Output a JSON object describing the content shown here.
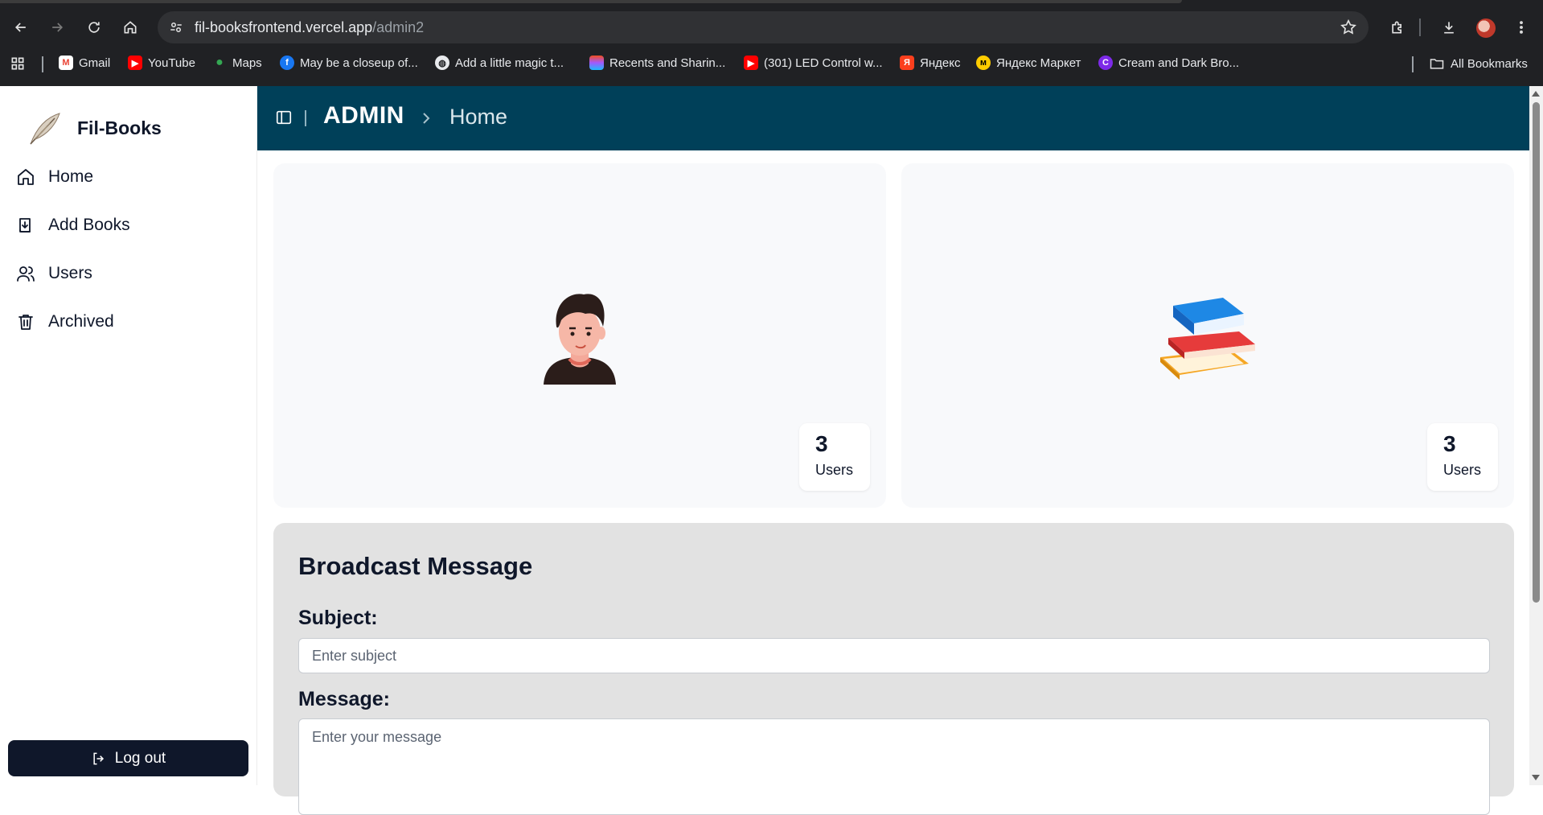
{
  "browser": {
    "url_host": "fil-booksfrontend.vercel.app",
    "url_path": "/admin2",
    "bookmarks": [
      {
        "label": "Gmail",
        "icon": "gmail-icon",
        "color": "#ea4335"
      },
      {
        "label": "YouTube",
        "icon": "youtube-icon",
        "color": "#ff0000"
      },
      {
        "label": "Maps",
        "icon": "maps-icon",
        "color": "#34a853"
      },
      {
        "label": "May be a closeup of...",
        "icon": "facebook-icon",
        "color": "#1877f2"
      },
      {
        "label": "Add a little magic t...",
        "icon": "globe-icon",
        "color": "#9aa0a6"
      },
      {
        "label": "Recents and Sharin...",
        "icon": "figma-icon",
        "color": "#a259ff"
      },
      {
        "label": "(301) LED Control w...",
        "icon": "youtube-icon",
        "color": "#ff0000"
      },
      {
        "label": "Яндекс",
        "icon": "yandex-icon",
        "color": "#fc3f1d"
      },
      {
        "label": "Яндекс Маркет",
        "icon": "yandex-market-icon",
        "color": "#ffcc00"
      },
      {
        "label": "Cream and Dark Bro...",
        "icon": "canva-icon",
        "color": "#7d2ae8"
      }
    ],
    "all_bookmarks": "All Bookmarks"
  },
  "sidebar": {
    "brand": "Fil-Books",
    "items": [
      {
        "label": "Home",
        "icon": "home-icon"
      },
      {
        "label": "Add Books",
        "icon": "add-book-icon"
      },
      {
        "label": "Users",
        "icon": "users-icon"
      },
      {
        "label": "Archived",
        "icon": "trash-icon"
      }
    ],
    "logout": "Log out"
  },
  "header": {
    "section": "ADMIN",
    "page": "Home",
    "color": "#004059"
  },
  "stats": [
    {
      "value": "3",
      "label": "Users",
      "illustration": "user-avatar-illustration"
    },
    {
      "value": "3",
      "label": "Users",
      "illustration": "books-stack-illustration"
    }
  ],
  "broadcast": {
    "title": "Broadcast Message",
    "subject_label": "Subject:",
    "subject_placeholder": "Enter subject",
    "message_label": "Message:",
    "message_placeholder": "Enter your message"
  }
}
